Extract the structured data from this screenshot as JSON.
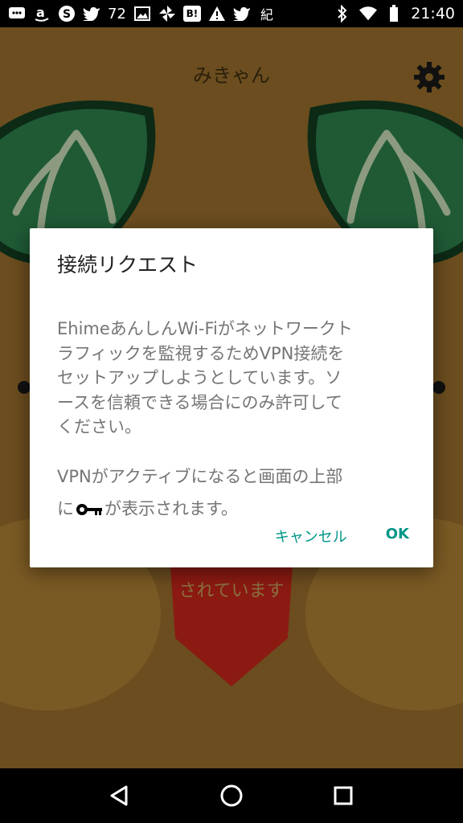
{
  "status_bar": {
    "notification_count": "72",
    "kanji_icon": "紀",
    "hatena_label": "B!",
    "time": "21:40",
    "icons": [
      "message-icon",
      "amazon-icon",
      "skype-icon",
      "twitter-icon",
      "image-icon",
      "pinwheel-icon",
      "hatena-icon",
      "warning-icon",
      "twitter-icon",
      "kanji-icon",
      "bluetooth-icon",
      "wifi-icon",
      "battery-icon"
    ]
  },
  "app": {
    "title": "みきゃん",
    "background_status": "されています",
    "colors": {
      "background": "#6b4d1f",
      "leaf": "#1f5a35",
      "heart": "#8b1a12"
    }
  },
  "dialog": {
    "title": "接続リクエスト",
    "body": "EhimeあんしんWi-Fiがネットワークト\nラフィックを監視するためVPN接続を\nセットアップしようとしています。ソ\nースを信頼できる場合にのみ許可して\nください。",
    "body2_line1": "VPNがアクティブになると画面の上部",
    "body2_prefix": "に",
    "body2_suffix": "が表示されます。",
    "cancel_label": "キャンセル",
    "ok_label": "OK",
    "accent_color": "#009688"
  },
  "nav_bar": {
    "icons": [
      "back-icon",
      "home-icon",
      "recents-icon"
    ]
  }
}
